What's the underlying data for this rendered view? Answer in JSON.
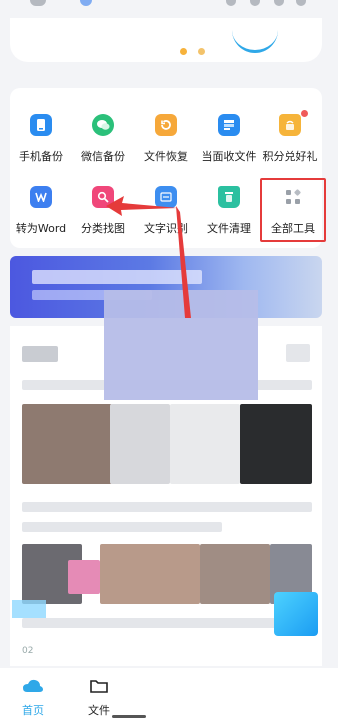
{
  "tools": [
    {
      "label": "手机备份",
      "icon": "phone-backup-icon",
      "color": "#2a8cf0"
    },
    {
      "label": "微信备份",
      "icon": "wechat-backup-icon",
      "color": "#2bc07a"
    },
    {
      "label": "文件恢复",
      "icon": "file-restore-icon",
      "color": "#f6a83a"
    },
    {
      "label": "当面收文件",
      "icon": "receive-file-icon",
      "color": "#2a8cf0"
    },
    {
      "label": "积分兑好礼",
      "icon": "gift-bag-icon",
      "color": "#f6b43a"
    },
    {
      "label": "转为Word",
      "icon": "word-convert-icon",
      "color": "#3d7ff0"
    },
    {
      "label": "分类找图",
      "icon": "image-search-icon",
      "color": "#f0477a"
    },
    {
      "label": "文字识别",
      "icon": "ocr-icon",
      "color": "#3d8ef0"
    },
    {
      "label": "文件清理",
      "icon": "file-clean-icon",
      "color": "#2bc0a0"
    },
    {
      "label": "全部工具",
      "icon": "all-tools-icon",
      "color": "#9aa0a8"
    }
  ],
  "feed": {
    "date": "02"
  },
  "nav": {
    "home_label": "首页",
    "files_label": "文件"
  },
  "colors": {
    "accent": "#2fa8e8",
    "highlight": "#e53b3b"
  }
}
